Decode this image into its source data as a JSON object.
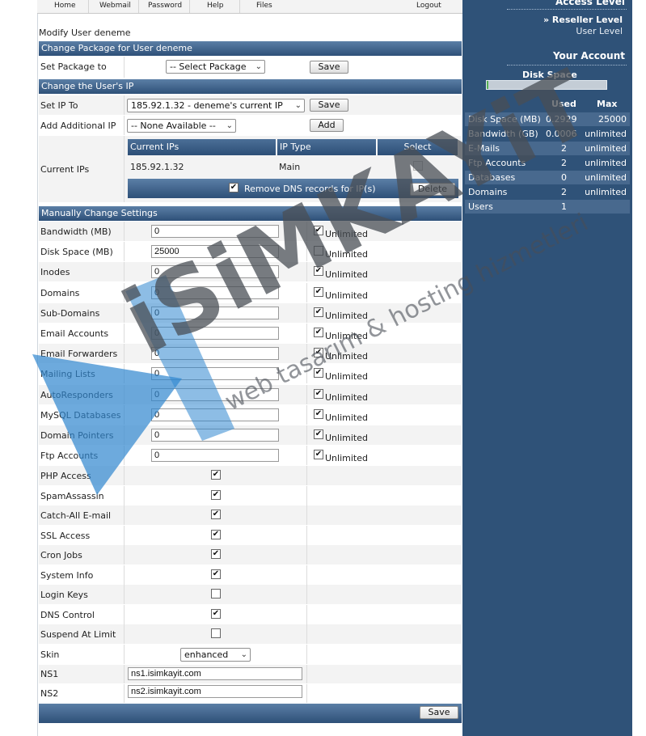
{
  "nav": {
    "home": "Home",
    "webmail": "Webmail",
    "password": "Password",
    "help": "Help",
    "files": "Files",
    "logout": "Logout"
  },
  "page_heading": "Modify User deneme",
  "package": {
    "section_title": "Change Package for User deneme",
    "label": "Set Package to",
    "select_value": "-- Select Package",
    "save_label": "Save"
  },
  "ip": {
    "section_title": "Change the User's IP",
    "set_label": "Set IP To",
    "set_value": "185.92.1.32 - deneme's current IP",
    "save_label": "Save",
    "additional_label": "Add Additional IP",
    "additional_value": "-- None Available --",
    "add_label": "Add",
    "current_label": "Current IPs",
    "table_headers": [
      "Current IPs",
      "IP Type",
      "Select"
    ],
    "table_row": {
      "ip": "185.92.1.32",
      "type": "Main"
    },
    "remove_dns_label": "Remove DNS records for IP(s)",
    "delete_label": "Delete"
  },
  "settings": {
    "section_title": "Manually Change Settings",
    "unlimited_label": "Unlimited",
    "limits": [
      {
        "label": "Bandwidth (MB)",
        "value": "0",
        "unlimited": true
      },
      {
        "label": "Disk Space (MB)",
        "value": "25000",
        "unlimited": false
      },
      {
        "label": "Inodes",
        "value": "0",
        "unlimited": true
      },
      {
        "label": "Domains",
        "value": "0",
        "unlimited": true
      },
      {
        "label": "Sub-Domains",
        "value": "0",
        "unlimited": true
      },
      {
        "label": "Email Accounts",
        "value": "0",
        "unlimited": true
      },
      {
        "label": "Email Forwarders",
        "value": "0",
        "unlimited": true
      },
      {
        "label": "Mailing Lists",
        "value": "0",
        "unlimited": true
      },
      {
        "label": "AutoResponders",
        "value": "0",
        "unlimited": true
      },
      {
        "label": "MySQL Databases",
        "value": "0",
        "unlimited": true
      },
      {
        "label": "Domain Pointers",
        "value": "0",
        "unlimited": true
      },
      {
        "label": "Ftp Accounts",
        "value": "0",
        "unlimited": true
      }
    ],
    "features": [
      {
        "label": "PHP Access",
        "checked": true
      },
      {
        "label": "SpamAssassin",
        "checked": true
      },
      {
        "label": "Catch-All E-mail",
        "checked": true
      },
      {
        "label": "SSL Access",
        "checked": true
      },
      {
        "label": "Cron Jobs",
        "checked": true
      },
      {
        "label": "System Info",
        "checked": true
      },
      {
        "label": "Login Keys",
        "checked": false
      },
      {
        "label": "DNS Control",
        "checked": true
      },
      {
        "label": "Suspend At Limit",
        "checked": false
      }
    ],
    "skin": {
      "label": "Skin",
      "value": "enhanced"
    },
    "ns1": {
      "label": "NS1",
      "value": "ns1.isimkayit.com"
    },
    "ns2": {
      "label": "NS2",
      "value": "ns2.isimkayit.com"
    },
    "save_label": "Save"
  },
  "sidebar": {
    "access_title": "Access Level",
    "reseller_level": "» Reseller Level",
    "user_level": "User Level",
    "account_title": "Your Account",
    "disk_space_label": "Disk Space",
    "disk_usage_fraction": 0.012,
    "col_used": "Used",
    "col_max": "Max",
    "stats": [
      {
        "name": "Disk Space (MB)",
        "used": "0.2929",
        "max": "25000"
      },
      {
        "name": "Bandwidth (GB)",
        "used": "0.0006",
        "max": "unlimited"
      },
      {
        "name": "E-Mails",
        "used": "2",
        "max": "unlimited"
      },
      {
        "name": "Ftp Accounts",
        "used": "2",
        "max": "unlimited"
      },
      {
        "name": "Databases",
        "used": "0",
        "max": "unlimited"
      },
      {
        "name": "Domains",
        "used": "2",
        "max": "unlimited"
      },
      {
        "name": "Users",
        "used": "1",
        "max": ""
      }
    ]
  },
  "watermark": {
    "brand": "iSiMKAYiT",
    "tagline": "web tasarım & hosting hizmetleri"
  },
  "colors": {
    "bar_blue": "#2e5078",
    "sidebar_blue": "#2f5278",
    "watermark_blue": "#2f86cf"
  }
}
